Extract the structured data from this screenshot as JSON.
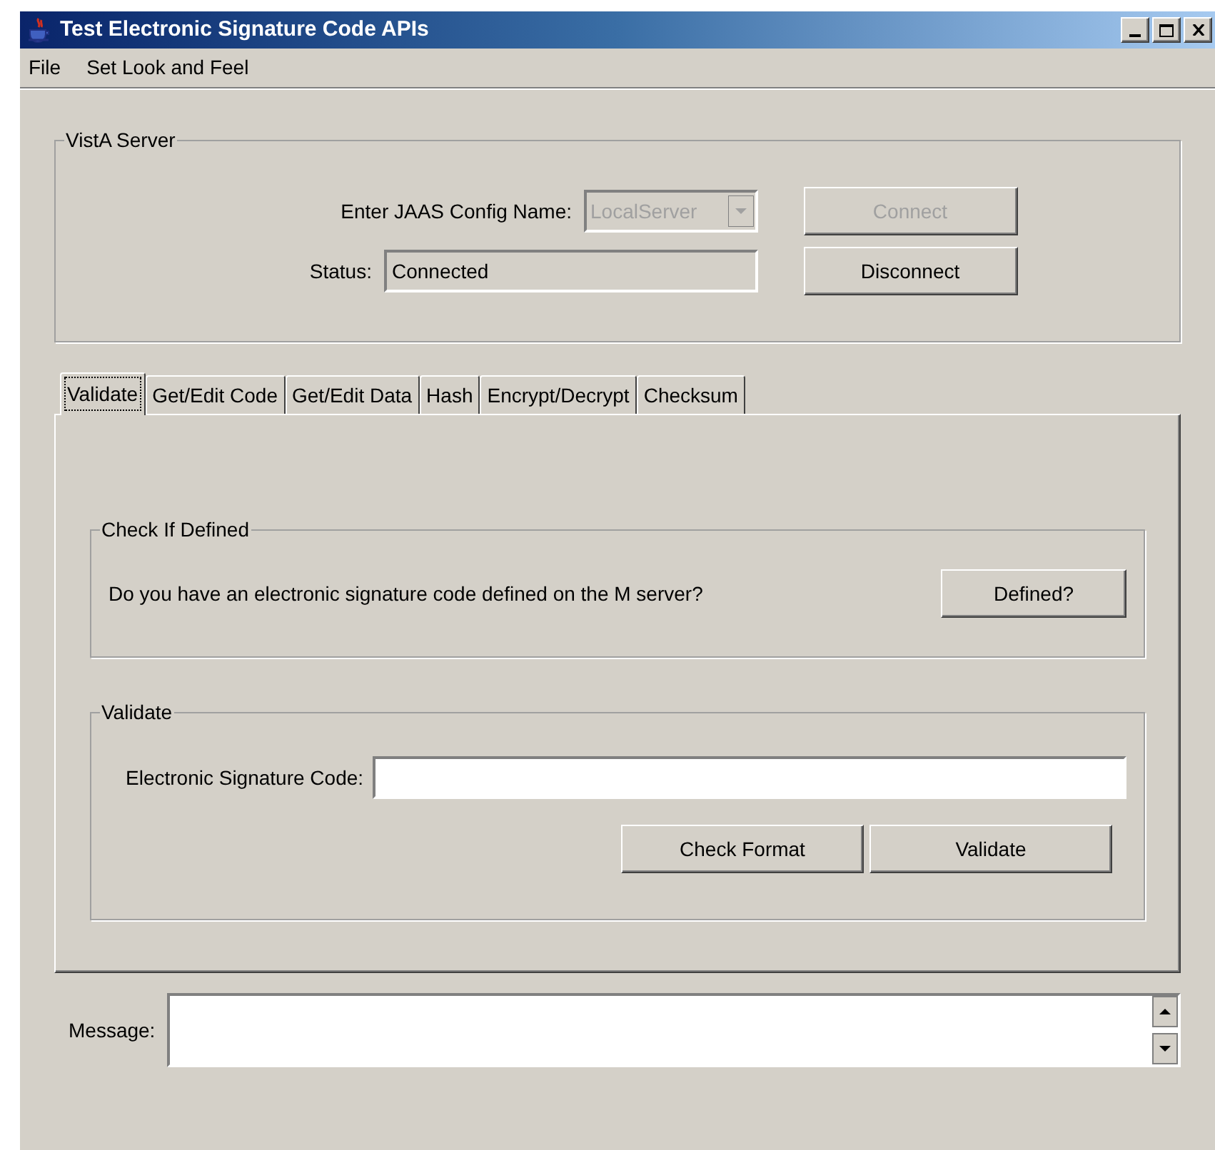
{
  "window": {
    "title": "Test Electronic Signature Code APIs"
  },
  "menu": [
    "File",
    "Set Look and Feel"
  ],
  "server_group": {
    "title": "VistA Server",
    "config_label": "Enter JAAS Config Name:",
    "config_value": "LocalServer",
    "config_disabled": true,
    "status_label": "Status:",
    "status_value": "Connected",
    "buttons": [
      {
        "label": "Connect",
        "disabled": true
      },
      {
        "label": "Disconnect",
        "disabled": false
      }
    ]
  },
  "tabs": [
    {
      "label": "Validate",
      "selected": true
    },
    {
      "label": "Get/Edit Code",
      "selected": false
    },
    {
      "label": "Get/Edit Data",
      "selected": false
    },
    {
      "label": "Hash",
      "selected": false
    },
    {
      "label": "Encrypt/Decrypt",
      "selected": false
    },
    {
      "label": "Checksum",
      "selected": false
    }
  ],
  "defined_group": {
    "title": "Check If Defined",
    "question": "Do you have an electronic signature code defined on the M server?",
    "button": "Defined?"
  },
  "validate_group": {
    "title": "Validate",
    "field_label": "Electronic Signature Code:",
    "buttons": [
      "Check Format",
      "Validate"
    ]
  },
  "message": {
    "label": "Message:"
  }
}
